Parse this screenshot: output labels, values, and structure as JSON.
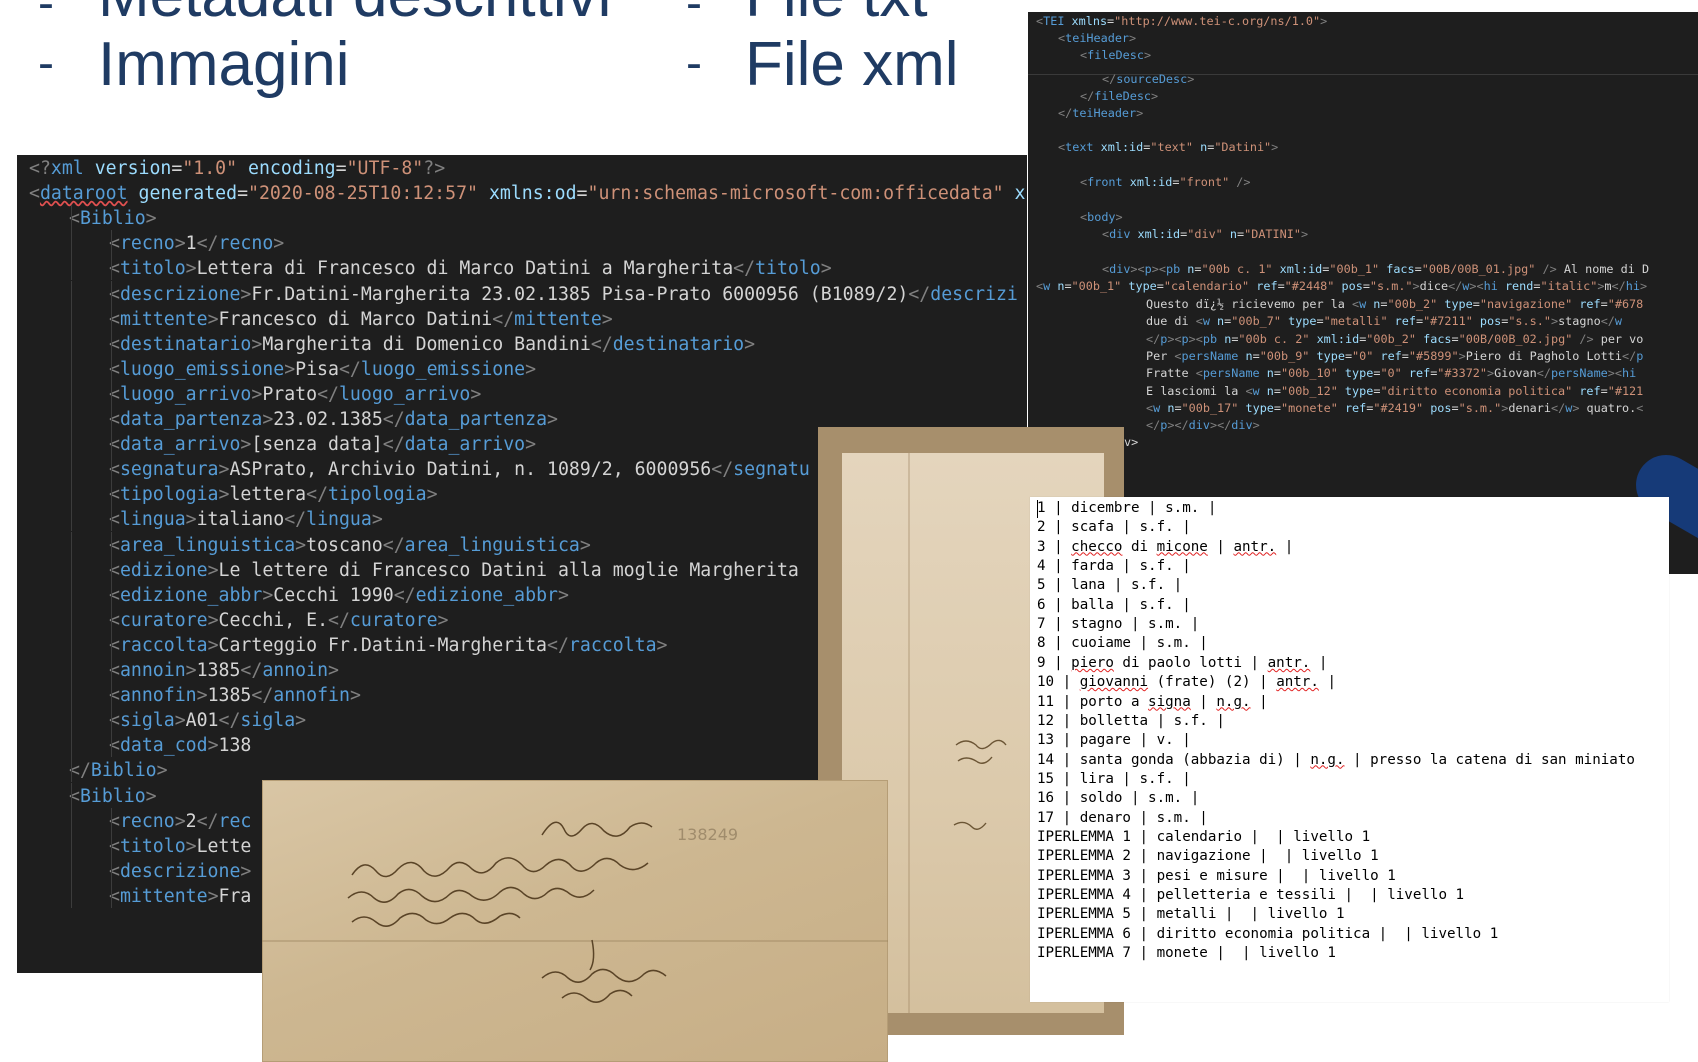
{
  "bullets": [
    {
      "dash": "-",
      "text": "Metadati descrittivi"
    },
    {
      "dash": "-",
      "text": "File txt"
    },
    {
      "dash": "-",
      "text": "Immagini"
    },
    {
      "dash": "-",
      "text": "File xml"
    }
  ],
  "xml_editor": {
    "lines": [
      "<?xml version=\"1.0\" encoding=\"UTF-8\"?>",
      "<dataroot generated=\"2020-08-25T10:12:57\" xmlns:od=\"urn:schemas-microsoft-com:officedata\" x",
      "<Biblio>",
      "<recno>1</recno>",
      "<titolo>Lettera di Francesco di Marco Datini a Margherita</titolo>",
      "<descrizione>Fr.Datini-Margherita 23.02.1385 Pisa-Prato 6000956 (B1089/2)</descrizi",
      "<mittente>Francesco di Marco Datini</mittente>",
      "<destinatario>Margherita di Domenico Bandini</destinatario>",
      "<luogo_emissione>Pisa</luogo_emissione>",
      "<luogo_arrivo>Prato</luogo_arrivo>",
      "<data_partenza>23.02.1385</data_partenza>",
      "<data_arrivo>[senza data]</data_arrivo>",
      "<segnatura>ASPrato, Archivio Datini, n. 1089/2, 6000956</segnatu",
      "<tipologia>lettera</tipologia>",
      "<lingua>italiano</lingua>",
      "<area_linguistica>toscano</area_linguistica>",
      "<edizione>Le lettere di Francesco Datini alla moglie Margherita",
      "<edizione_abbr>Cecchi 1990</edizione_abbr>",
      "<curatore>Cecchi, E.</curatore>",
      "<raccolta>Carteggio Fr.Datini-Margherita</raccolta>",
      "<annoin>1385</annoin>",
      "<annofin>1385</annofin>",
      "<sigla>A01</sigla>",
      "<data_cod>138",
      "</Biblio>",
      "<Biblio>",
      "<recno>2</rec",
      "<titolo>Lette",
      "<descrizione>",
      "<mittente>Fra"
    ]
  },
  "tei_editor": {
    "lines": [
      "<TEI xmlns=\"http://www.tei-c.org/ns/1.0\">",
      "<teiHeader>",
      "<fileDesc>",
      "</sourceDesc>",
      "</fileDesc>",
      "</teiHeader>",
      "<text xml:id=\"text\" n=\"Datini\">",
      "<front xml:id=\"front\" />",
      "<body>",
      "<div xml:id=\"div\" n=\"DATINI\">",
      "<div><p><pb n=\"00b c. 1\" xml:id=\"00b_1\" facs=\"00B/00B_01.jpg\" /> Al nome di D",
      "<w n=\"00b_1\" type=\"calendario\" ref=\"#2448\" pos=\"s.m.\">dice</w><hi rend=\"italic\">m</hi>",
      "Questo dï¿½ ricievemo per la <w n=\"00b_2\" type=\"navigazione\" ref=\"#678",
      "due di <w n=\"00b_7\" type=\"metalli\" ref=\"#7211\" pos=\"s.s.\">stagno</w",
      "</p><p><pb n=\"00b c. 2\" xml:id=\"00b_2\" facs=\"00B/00B_02.jpg\" /> per vo",
      "Per <persName n=\"00b_9\" type=\"0\" ref=\"#5899\">Piero di Pagholo Lotti</p",
      "Fratte <persName n=\"00b_10\" type=\"0\" ref=\"#3372\">Giovan</persName><hi",
      "E lasciomi la <w n=\"00b_12\" type=\"diritto economia politica\" ref=\"#121",
      "<w n=\"00b_17\" type=\"monete\" ref=\"#2419\" pos=\"s.m.\">denari</w> quatro.<",
      "</p></div></div>",
      "v>"
    ]
  },
  "lemma_list": {
    "lines": [
      "1 | dicembre | s.m. |",
      "2 | scafa | s.f. |",
      "3 | checco di micone | antr. |",
      "4 | farda | s.f. |",
      "5 | lana | s.f. |",
      "6 | balla | s.f. |",
      "7 | stagno | s.m. |",
      "8 | cuoiame | s.m. |",
      "9 | piero di paolo lotti | antr. |",
      "10 | giovanni (frate) (2) | antr. |",
      "11 | porto a signa | n.g. |",
      "12 | bolletta | s.f. |",
      "13 | pagare | v. |",
      "14 | santa gonda (abbazia di) | n.g. | presso la catena di san miniato",
      "15 | lira | s.f. |",
      "16 | soldo | s.m. |",
      "17 | denaro | s.m. |",
      "IPERLEMMA 1 | calendario |  | livello 1",
      "IPERLEMMA 2 | navigazione |  | livello 1",
      "IPERLEMMA 3 | pesi e misure |  | livello 1",
      "IPERLEMMA 4 | pelletteria e tessili |  | livello 1",
      "IPERLEMMA 5 | metalli |  | livello 1",
      "IPERLEMMA 6 | diritto economia politica |  | livello 1",
      "IPERLEMMA 7 | monete |  | livello 1"
    ]
  },
  "photos": {
    "letter_front_annotation": "138249"
  }
}
